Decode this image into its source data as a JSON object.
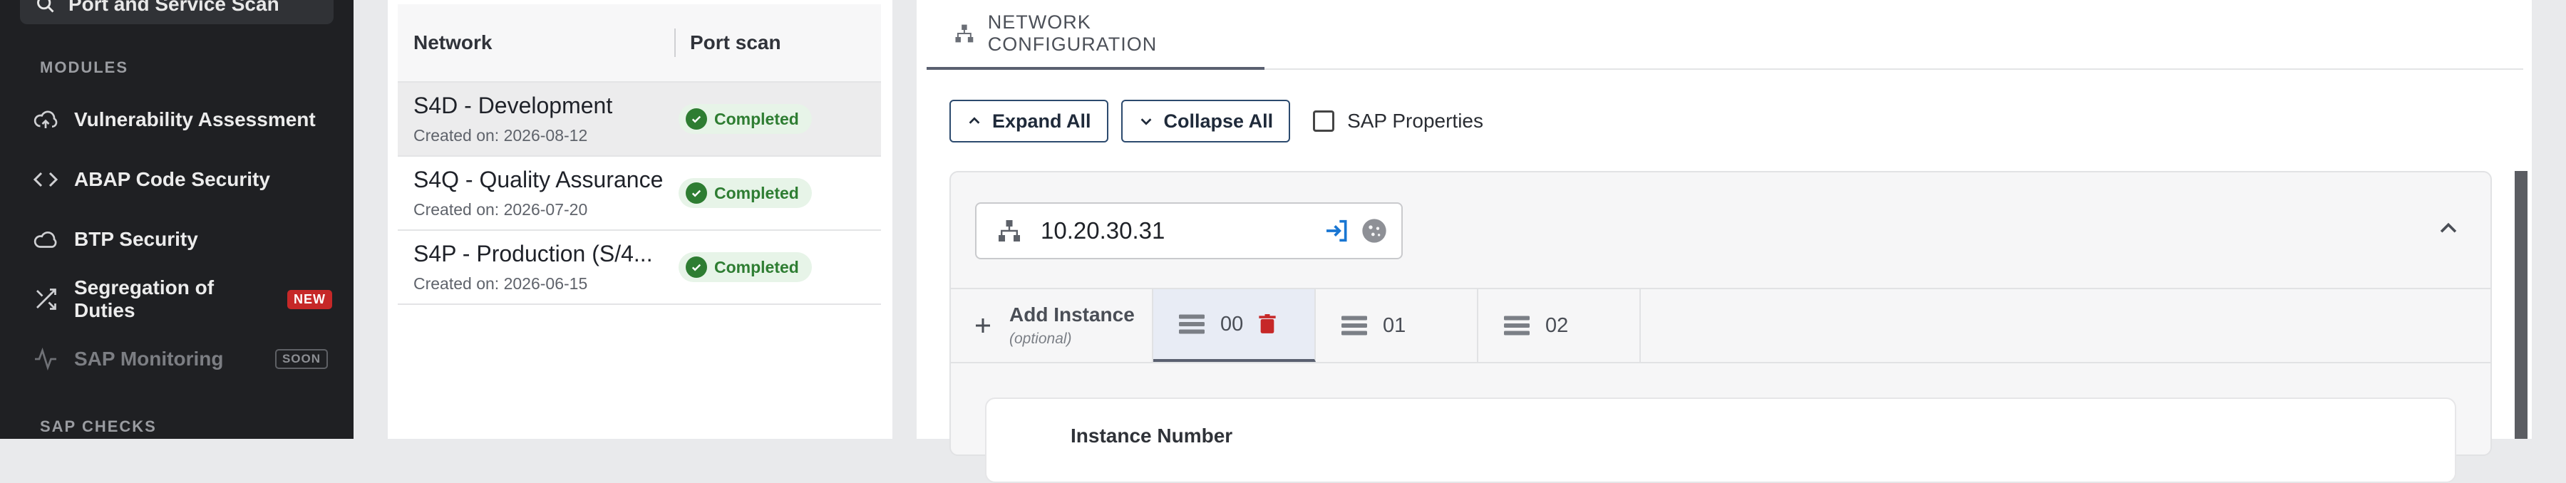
{
  "sidebar": {
    "search_label": "Port and Service Scan",
    "modules_heading": "MODULES",
    "items": [
      {
        "label": "Vulnerability Assessment",
        "icon": "cloud-upload-icon"
      },
      {
        "label": "ABAP Code Security",
        "icon": "code-icon"
      },
      {
        "label": "BTP Security",
        "icon": "cloud-icon"
      },
      {
        "label": "Segregation of Duties",
        "icon": "shuffle-icon",
        "badge": "NEW"
      },
      {
        "label": "SAP Monitoring",
        "icon": "activity-icon",
        "badge": "SOON",
        "disabled": true
      }
    ],
    "sap_checks_heading": "SAP CHECKS"
  },
  "network_list": {
    "columns": [
      "Network",
      "Port scan"
    ],
    "rows": [
      {
        "name": "S4D - Development",
        "created": "Created on: 2026-08-12",
        "status": "Completed",
        "selected": true
      },
      {
        "name": "S4Q - Quality Assurance",
        "created": "Created on: 2026-07-20",
        "status": "Completed"
      },
      {
        "name": "S4P - Production (S/4...",
        "created": "Created on: 2026-06-15",
        "status": "Completed"
      }
    ]
  },
  "config": {
    "tab_label": "NETWORK CONFIGURATION",
    "expand_all": "Expand All",
    "collapse_all": "Collapse All",
    "sap_properties": "SAP Properties",
    "ip_address": "10.20.30.31",
    "add_instance": "Add Instance",
    "add_instance_hint": "(optional)",
    "instances": [
      "00",
      "01",
      "02"
    ],
    "instance_number_label": "Instance Number"
  },
  "colors": {
    "sidebar_bg": "#1f2023",
    "accent_blue": "#1976d2",
    "success_green": "#2e7d32",
    "danger_red": "#c62828"
  }
}
